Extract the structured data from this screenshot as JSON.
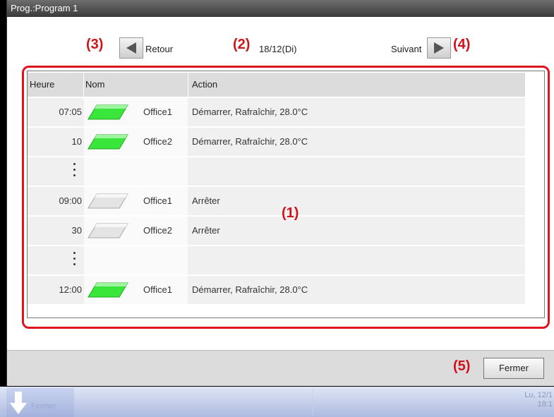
{
  "window": {
    "title": "Prog.:Program 1"
  },
  "annotations": {
    "list": "(1)",
    "date": "(2)",
    "back": "(3)",
    "next": "(4)",
    "close": "(5)"
  },
  "nav": {
    "back_label": "Retour",
    "date": "18/12(Di)",
    "next_label": "Suivant"
  },
  "table": {
    "headers": [
      "Heure",
      "Nom",
      "Action"
    ],
    "rows": [
      {
        "time": "07:05",
        "icon": "unit-on-icon",
        "name": "Office1",
        "action": "Démarrer, Rafraîchir, 28.0°C"
      },
      {
        "time": "10",
        "icon": "unit-on-icon",
        "name": "Office2",
        "action": "Démarrer, Rafraîchir, 28.0°C"
      },
      {
        "time": "",
        "icon": "",
        "name": "",
        "action": ""
      },
      {
        "time": "09:00",
        "icon": "unit-off-icon",
        "name": "Office1",
        "action": "Arrêter"
      },
      {
        "time": "30",
        "icon": "unit-off-icon",
        "name": "Office2",
        "action": "Arrêter"
      },
      {
        "time": "",
        "icon": "",
        "name": "",
        "action": ""
      },
      {
        "time": "12:00",
        "icon": "unit-on-icon",
        "name": "Office1",
        "action": "Démarrer, Rafraîchir, 28.0°C"
      }
    ]
  },
  "footer": {
    "close_label": "Fermer"
  },
  "taskbar": {
    "button_label": "Fermer",
    "date_line1": "Lu, 12/1",
    "date_line2": "18:1"
  },
  "colors": {
    "highlight": "#e0141e",
    "unit_on": "#3be63b",
    "unit_off": "#d6d6d6"
  }
}
